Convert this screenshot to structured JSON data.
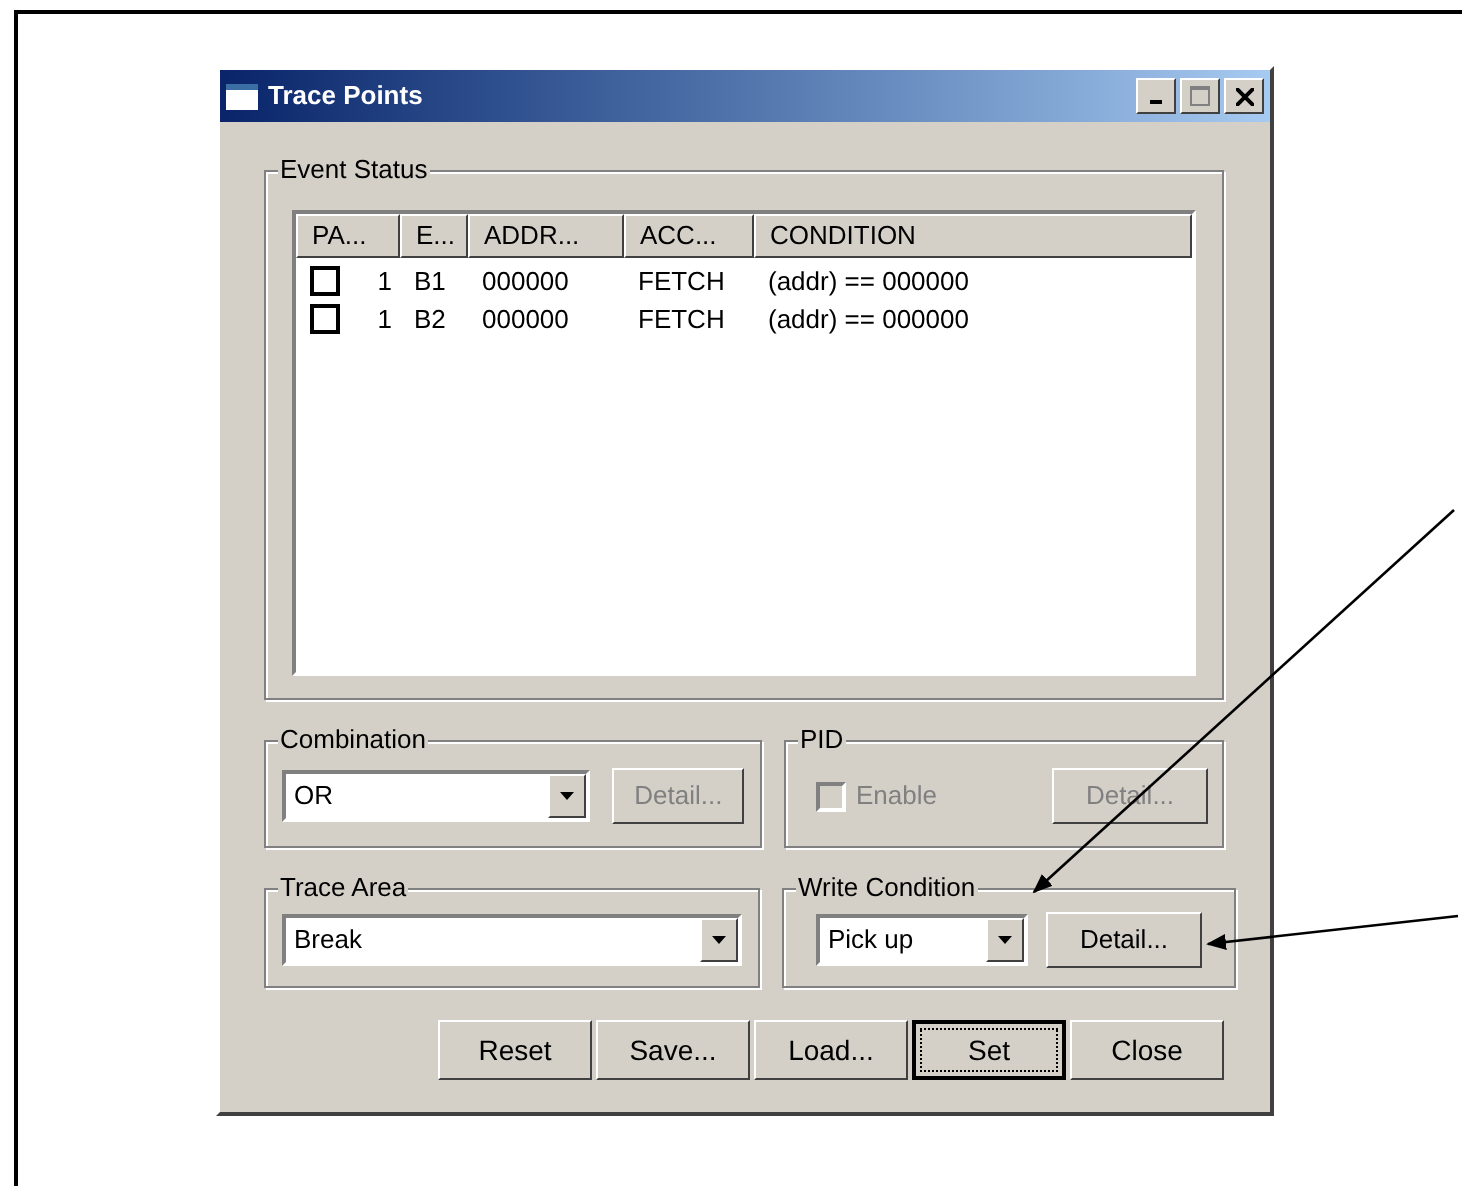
{
  "window": {
    "title": "Trace Points"
  },
  "event_status": {
    "label": "Event Status",
    "columns": [
      "PA...",
      "E...",
      "ADDR...",
      "ACC...",
      "CONDITION"
    ],
    "rows": [
      {
        "checked": false,
        "cells": [
          "1",
          "B1",
          "000000",
          "FETCH",
          "(addr) == 000000"
        ]
      },
      {
        "checked": false,
        "cells": [
          "1",
          "B2",
          "000000",
          "FETCH",
          "(addr) == 000000"
        ]
      }
    ]
  },
  "combination": {
    "label": "Combination",
    "value": "OR",
    "detail": {
      "label": "Detail...",
      "disabled": true
    }
  },
  "pid": {
    "label": "PID",
    "enable": {
      "label": "Enable",
      "checked": false,
      "disabled": true
    },
    "detail": {
      "label": "Detail...",
      "disabled": true
    }
  },
  "trace_area": {
    "label": "Trace Area",
    "value": "Break"
  },
  "write_condition": {
    "label": "Write Condition",
    "value": "Pick up",
    "detail": {
      "label": "Detail...",
      "disabled": false
    }
  },
  "buttons": [
    {
      "label": "Reset",
      "default": false
    },
    {
      "label": "Save...",
      "default": false
    },
    {
      "label": "Load...",
      "default": false
    },
    {
      "label": "Set",
      "default": true
    },
    {
      "label": "Close",
      "default": false
    }
  ]
}
